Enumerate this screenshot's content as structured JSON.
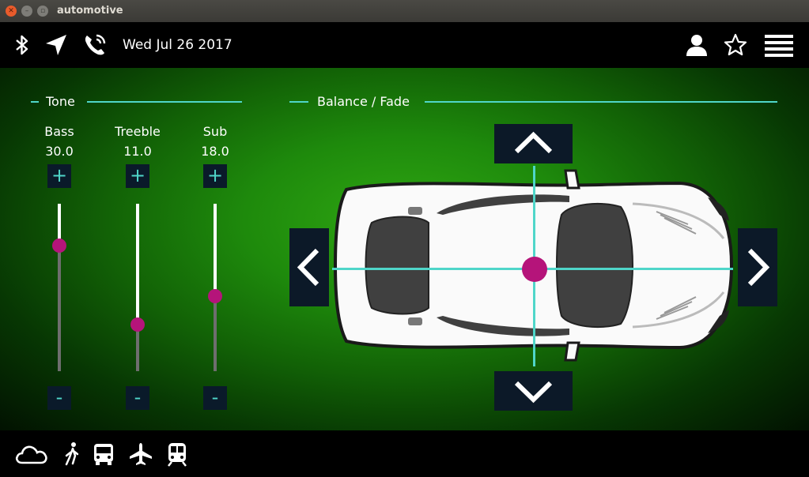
{
  "window": {
    "title": "automotive"
  },
  "topbar": {
    "date": "Wed Jul 26 2017",
    "icons": [
      "bluetooth-icon",
      "navigation-icon",
      "phone-call-icon",
      "user-icon",
      "star-icon",
      "menu-icon"
    ]
  },
  "tone": {
    "title": "Tone",
    "controls": [
      {
        "label": "Bass",
        "value": "30.0",
        "plus": "+",
        "minus": "-",
        "level": 0.75
      },
      {
        "label": "Treeble",
        "value": "11.0",
        "plus": "+",
        "minus": "-",
        "level": 0.28
      },
      {
        "label": "Sub",
        "value": "18.0",
        "plus": "+",
        "minus": "-",
        "level": 0.45
      }
    ]
  },
  "balance": {
    "title": "Balance / Fade",
    "balance": 0.0,
    "fade": 0.0
  },
  "bottombar": {
    "icons": [
      "weather-cloud-icon",
      "walk-icon",
      "bus-icon",
      "airplane-icon",
      "train-icon"
    ]
  },
  "colors": {
    "accent": "#4fd6c9",
    "knob": "#b5147a",
    "button_bg": "#0c1928"
  }
}
